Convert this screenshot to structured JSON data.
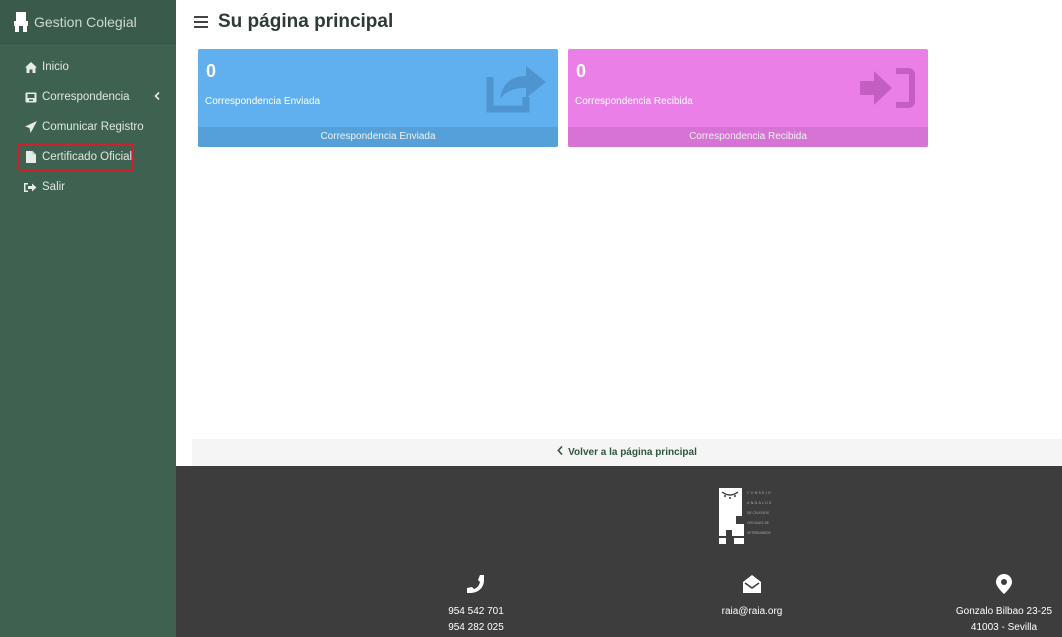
{
  "sidebar": {
    "brand": "Gestion Colegial",
    "items": [
      {
        "label": "Inicio",
        "icon": "home-icon"
      },
      {
        "label": "Correspondencia",
        "icon": "inbox-icon"
      },
      {
        "label": "Comunicar Registro",
        "icon": "paper-plane-icon"
      },
      {
        "label": "Certificado Oficial",
        "icon": "file-icon"
      },
      {
        "label": "Salir",
        "icon": "sign-out-icon"
      }
    ]
  },
  "header": {
    "title": "Su página principal"
  },
  "cards": [
    {
      "count": "0",
      "label": "Correspondencia Enviada",
      "footer": "Correspondencia Enviada",
      "icon": "share-square-icon",
      "color": "#60b0ef"
    },
    {
      "count": "0",
      "label": "Correspondencia Recibida",
      "footer": "Correspondencia Recibida",
      "icon": "sign-in-icon",
      "color": "#ea7fe8"
    }
  ],
  "back_link": "Volver a la página principal",
  "footer": {
    "logo_lines": [
      "CONSEJO",
      "ANDALUZ",
      "DE COLEGIOS",
      "OFICIALES DE",
      "VETERINARIOS"
    ],
    "phone_1": "954 542 701",
    "phone_2": "954 282 025",
    "email": "raia@raia.org",
    "address_1": "Gonzalo Bilbao 23-25",
    "address_2": "41003 - Sevilla"
  },
  "colors": {
    "sidebar": "#3f6150",
    "highlight": "#d0202d",
    "footer": "#3d3d3d"
  }
}
